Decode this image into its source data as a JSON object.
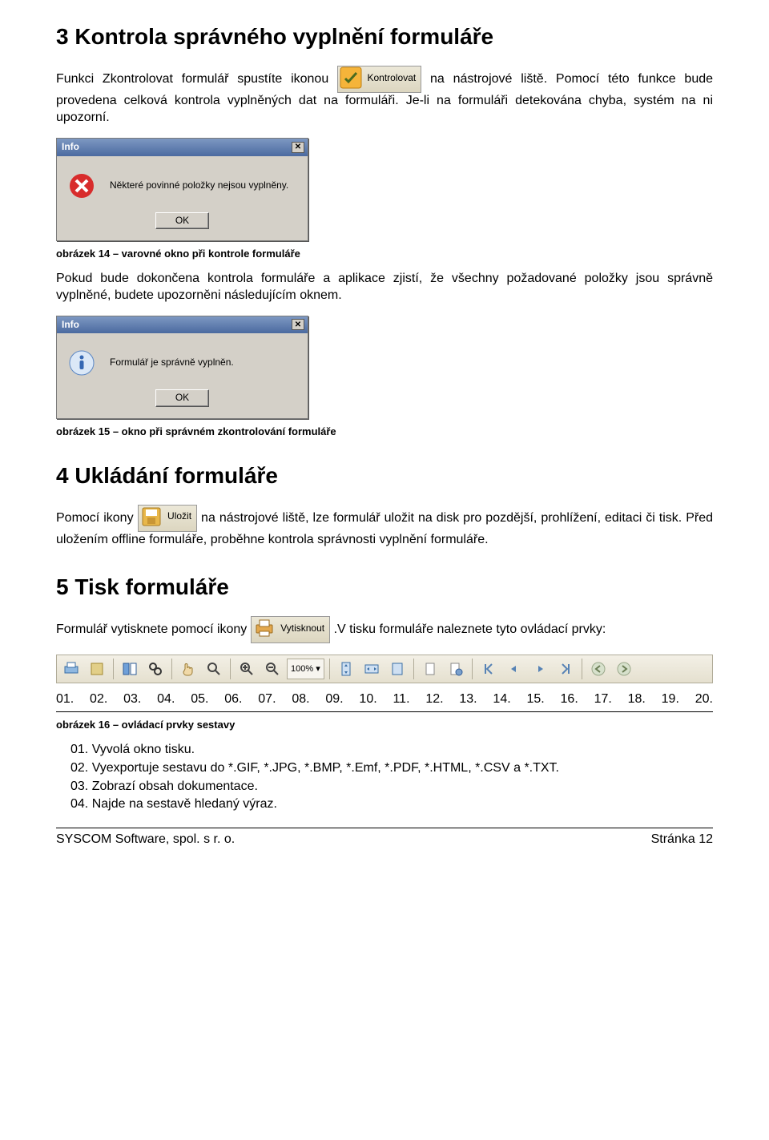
{
  "s3": {
    "title": "3  Kontrola správného vyplnění formuláře",
    "p1a": "Funkci Zkontrolovat formulář spustíte ikonou ",
    "button_label": "Kontrolovat",
    "p1b": " na nástrojové liště. Pomocí této funkce bude provedena celková kontrola vyplněných dat na formuláři. Je-li na formuláři detekována chyba, systém na ni upozorní.",
    "dlg1": {
      "title": "Info",
      "text": "Některé povinné položky nejsou vyplněny.",
      "ok": "OK"
    },
    "caption14": "obrázek 14 – varovné okno při kontrole formuláře",
    "p2": "Pokud bude dokončena kontrola formuláře a aplikace zjistí, že všechny požadované položky jsou správně vyplněné, budete upozorněni následujícím oknem.",
    "dlg2": {
      "title": "Info",
      "text": "Formulář je správně vyplněn.",
      "ok": "OK"
    },
    "caption15": "obrázek 15 – okno při správném zkontrolování formuláře"
  },
  "s4": {
    "title": "4  Ukládání formuláře",
    "p1a": "Pomocí ikony ",
    "button_label": "Uložit",
    "p1b": " na nástrojové liště, lze formulář uložit na disk pro pozdější, prohlížení, editaci či tisk. Před uložením offline formuláře, proběhne kontrola správnosti vyplnění formuláře."
  },
  "s5": {
    "title": "5  Tisk formuláře",
    "p1a": "Formulář vytisknete pomocí ikony ",
    "button_label": "Vytisknout",
    "p1b": ".V tisku formuláře naleznete tyto ovládací prvky:",
    "zoom": "100%",
    "numbers": [
      "01.",
      "02.",
      "03.",
      "04.",
      "05.",
      "06.",
      "07.",
      "08.",
      "09.",
      "10.",
      "11.",
      "12.",
      "13.",
      "14.",
      "15.",
      "16.",
      "17.",
      "18.",
      "19.",
      "20."
    ],
    "caption16": "obrázek 16 – ovládací prvky sestavy",
    "legend": [
      "01.  Vyvolá okno tisku.",
      "02.  Vyexportuje sestavu do *.GIF, *.JPG, *.BMP, *.Emf, *.PDF, *.HTML, *.CSV a *.TXT.",
      "03.  Zobrazí obsah dokumentace.",
      "04.  Najde na sestavě hledaný výraz."
    ]
  },
  "footer": {
    "left": "SYSCOM Software, spol. s r. o.",
    "right": "Stránka 12"
  }
}
